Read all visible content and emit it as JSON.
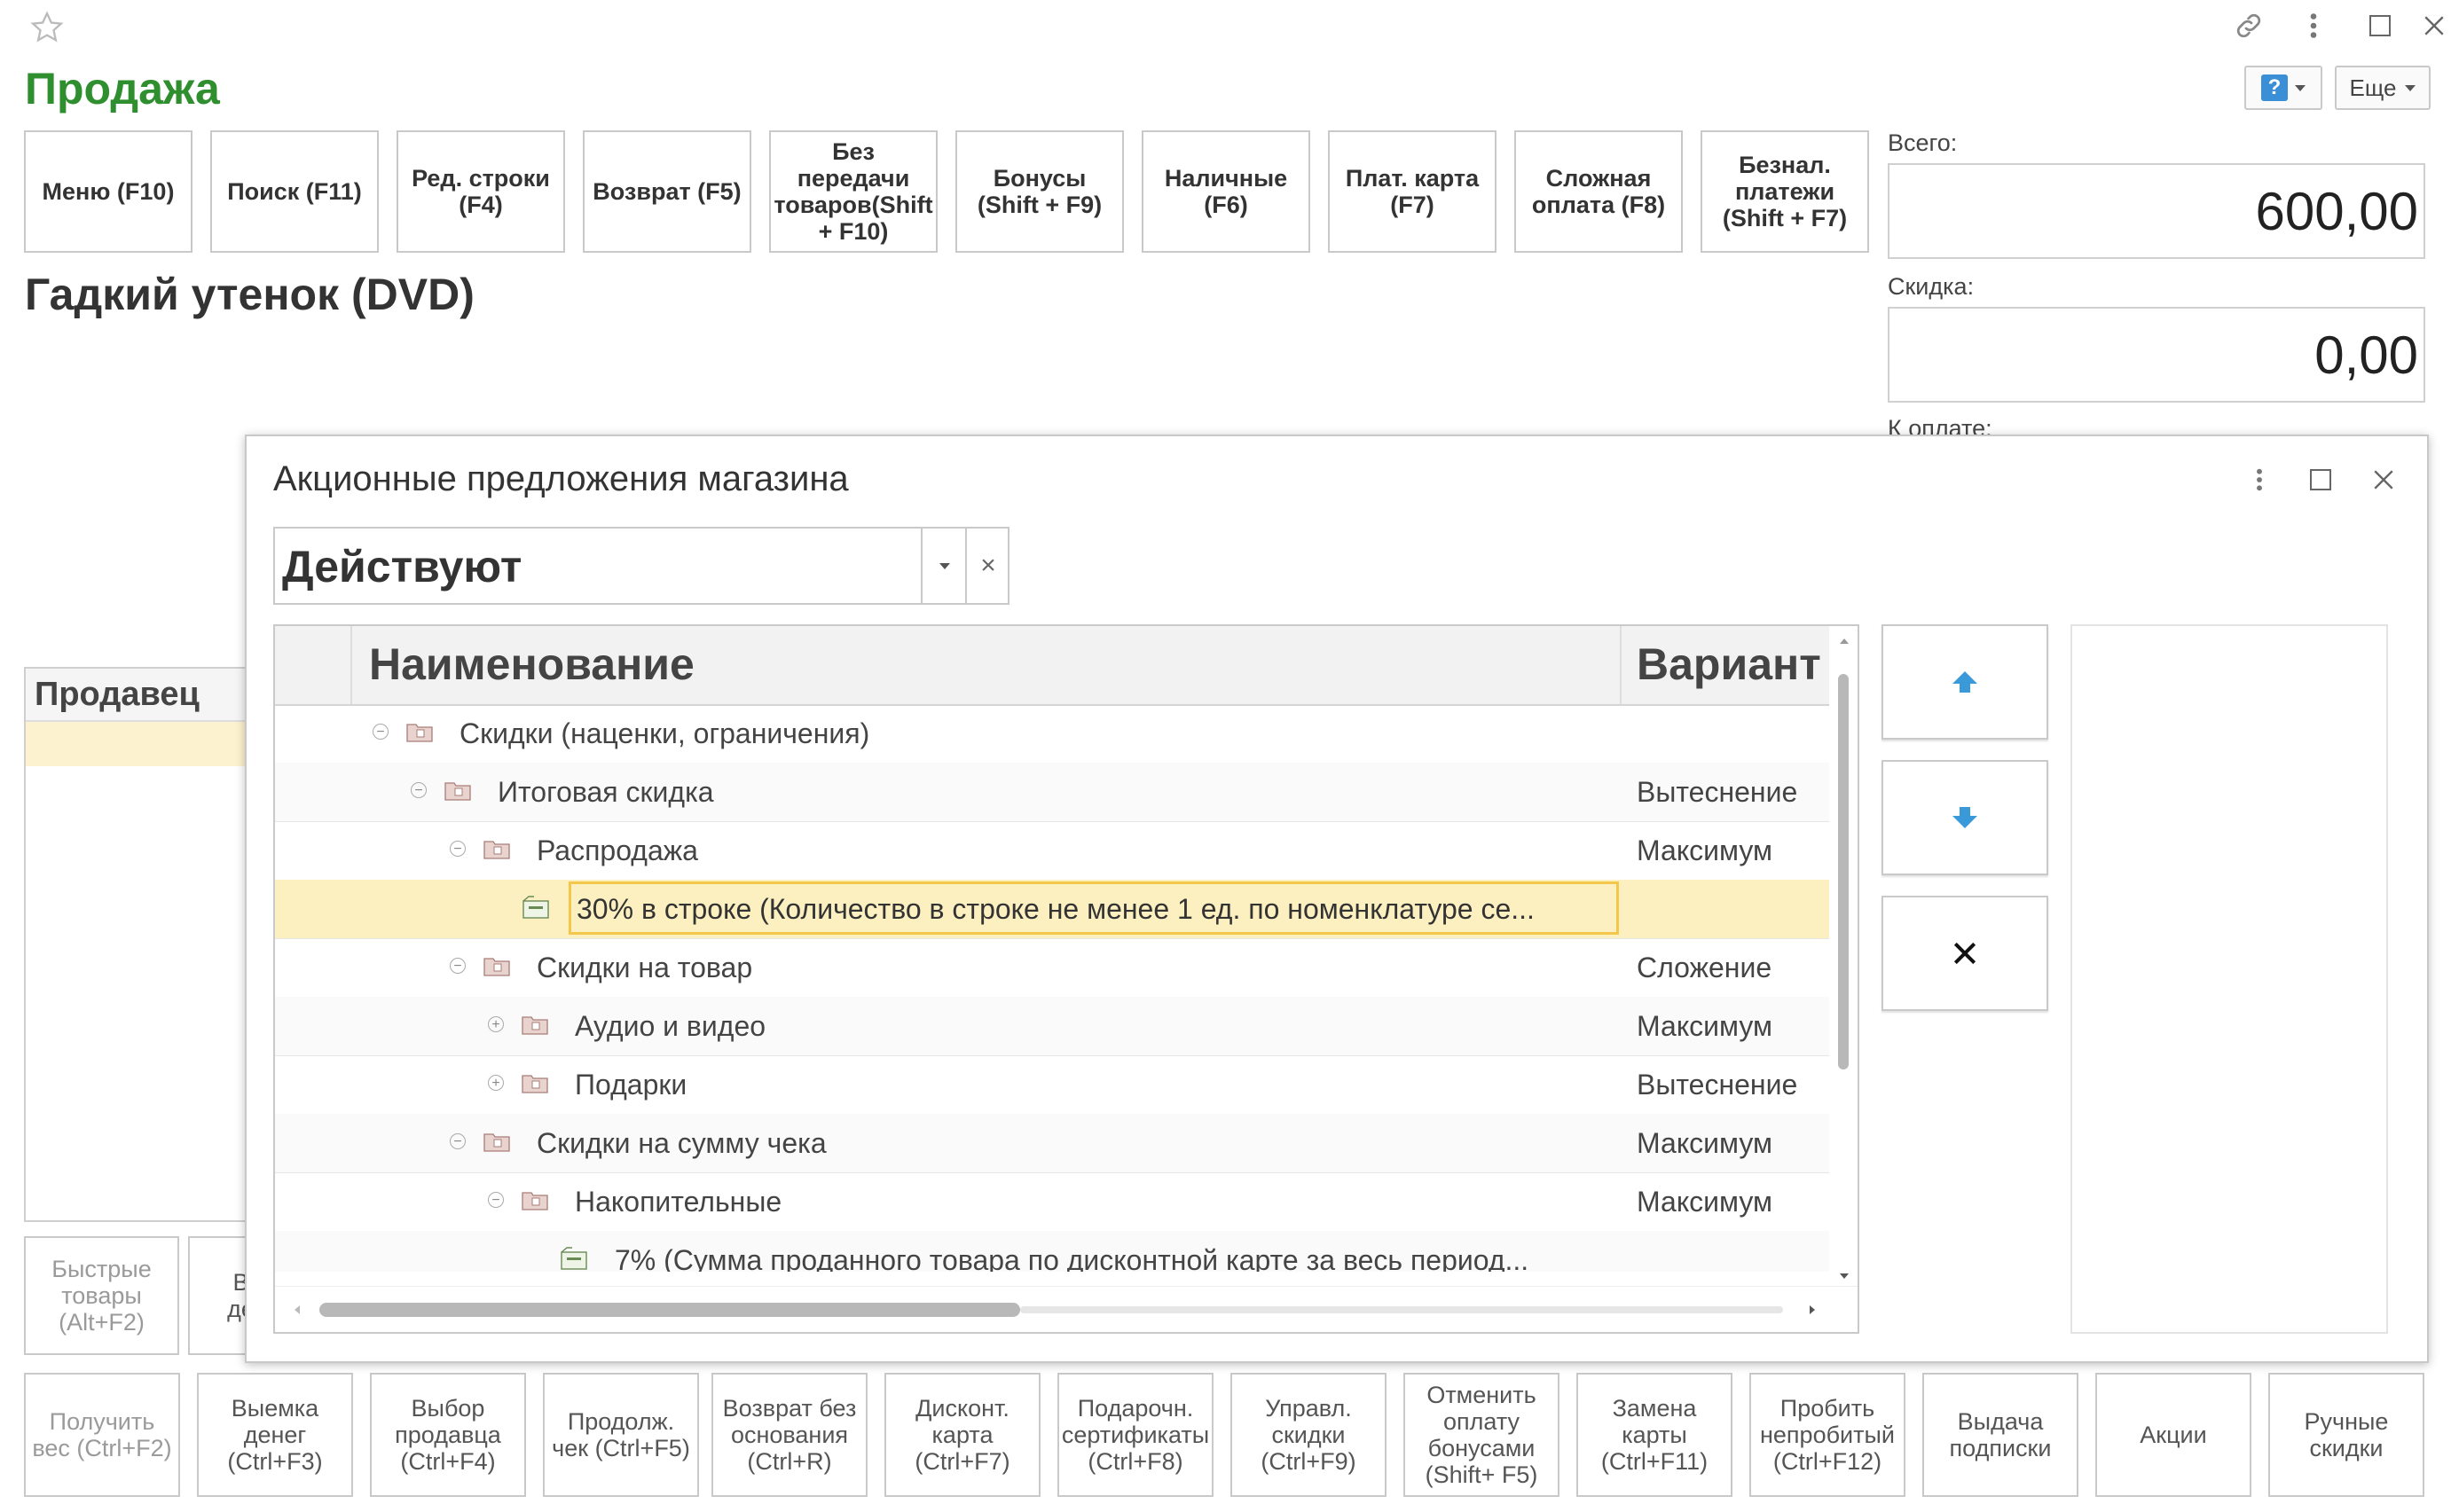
{
  "window": {
    "title": "Продажа",
    "more_label": "Еще"
  },
  "toolbar_buttons": [
    "Меню (F10)",
    "Поиск (F11)",
    "Ред. строки (F4)",
    "Возврат (F5)",
    "Без передачи товаров(Shift + F10)",
    "Бонусы (Shift + F9)",
    "Наличные (F6)",
    "Плат. карта (F7)",
    "Сложная оплата (F8)",
    "Безнал. платежи (Shift + F7)"
  ],
  "product": {
    "name": "Гадкий утенок (DVD)"
  },
  "totals": {
    "total_label": "Всего:",
    "total_value": "600,00",
    "discount_label": "Скидка:",
    "discount_value": "0,00",
    "to_pay_label": "К оплате:"
  },
  "seller": {
    "header": "Продавец"
  },
  "side_buttons": {
    "quick": "Быстрые товары (Alt+F2)",
    "partial": "Вн ден"
  },
  "bottom_buttons": [
    "Получить вес (Ctrl+F2)",
    "Выемка денег (Ctrl+F3)",
    "Выбор продавца (Ctrl+F4)",
    "Продолж. чек (Ctrl+F5)",
    "Возврат без основания (Ctrl+R)",
    "Дисконт. карта (Ctrl+F7)",
    "Подарочн. сертификаты (Ctrl+F8)",
    "Управл. скидки (Ctrl+F9)",
    "Отменить оплату бонусами (Shift+ F5)",
    "Замена карты (Ctrl+F11)",
    "Пробить непробитый (Ctrl+F12)",
    "Выдача подписки",
    "Акции",
    "Ручные скидки"
  ],
  "dialog": {
    "title": "Акционные предложения магазина",
    "filter_value": "Действуют",
    "columns": {
      "name": "Наименование",
      "variant": "Вариант"
    },
    "rows": [
      {
        "name": "Скидки (наценки, ограничения)",
        "variant": "",
        "toggle": "⊖"
      },
      {
        "name": "Итоговая скидка",
        "variant": "Вытеснение",
        "toggle": "⊖"
      },
      {
        "name": "Распродажа",
        "variant": "Максимум",
        "toggle": "⊖"
      },
      {
        "name": "30% в строке (Количество в строке не менее 1 ед. по номенклатуре се...",
        "variant": "",
        "toggle": ""
      },
      {
        "name": "Скидки на товар",
        "variant": "Сложение",
        "toggle": "⊖"
      },
      {
        "name": "Аудио и видео",
        "variant": "Максимум",
        "toggle": "⊕"
      },
      {
        "name": "Подарки",
        "variant": "Вытеснение",
        "toggle": "⊕"
      },
      {
        "name": "Скидки на сумму чека",
        "variant": "Максимум",
        "toggle": "⊖"
      },
      {
        "name": "Накопительные",
        "variant": "Максимум",
        "toggle": "⊖"
      },
      {
        "name": "7% (Сумма проданного товара по дисконтной карте за весь период...",
        "variant": "",
        "toggle": ""
      }
    ],
    "close_glyph": "×"
  },
  "icons": {
    "star": "star-icon",
    "link": "link-icon",
    "more": "more-vert-icon",
    "maximize": "maximize-icon",
    "close": "close-icon",
    "help": "help-icon",
    "move_up": "arrow-up-icon",
    "move_down": "arrow-down-icon",
    "delete": "delete-x-icon"
  },
  "colors": {
    "title_green": "#2f8f2f",
    "selected_row": "#fdf0c0",
    "selected_border": "#f3c84a",
    "arrow_blue": "#3a9ad9",
    "seller_row": "#fdf2cf"
  }
}
